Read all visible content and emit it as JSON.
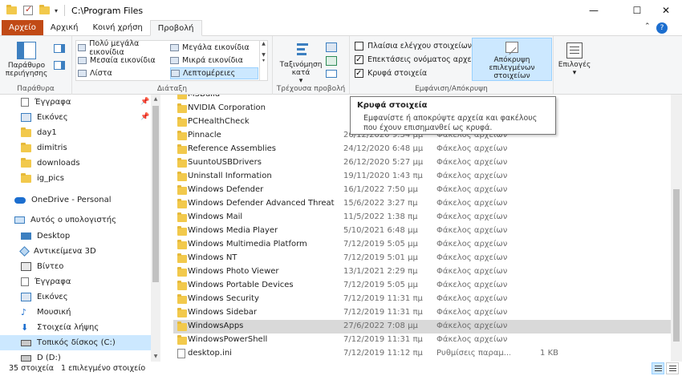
{
  "window": {
    "title": "C:\\Program Files",
    "min": "—",
    "max": "☐",
    "close": "✕"
  },
  "tabs": {
    "file": "Αρχείο",
    "home": "Αρχική",
    "share": "Κοινή χρήση",
    "view": "Προβολή"
  },
  "ribbon": {
    "panes": {
      "nav_pane": "Παράθυρο περιήγησης",
      "label": "Παράθυρα"
    },
    "layout": {
      "extra_large": "Πολύ μεγάλα εικονίδια",
      "large": "Μεγάλα εικονίδια",
      "medium": "Μεσαία εικονίδια",
      "small": "Μικρά εικονίδια",
      "list": "Λίστα",
      "details": "Λεπτομέρειες",
      "label": "Διάταξη"
    },
    "current_view": {
      "sort_by": "Ταξινόμηση κατά",
      "label": "Τρέχουσα προβολή"
    },
    "show_hide": {
      "item_checkboxes": "Πλαίσια ελέγχου στοιχείων",
      "file_extensions": "Επεκτάσεις ονόματος αρχείων",
      "hidden_items": "Κρυφά στοιχεία",
      "hide_selected": "Απόκρυψη επιλεγμένων στοιχείων",
      "item_checkboxes_checked": false,
      "file_extensions_checked": true,
      "hidden_items_checked": true,
      "label": "Εμφάνιση/Απόκρυψη"
    },
    "options": "Επιλογές"
  },
  "nav": {
    "quick": [
      "Έγγραφα",
      "Εικόνες",
      "day1",
      "dimitris",
      "downloads",
      "ig_pics"
    ],
    "onedrive": "OneDrive - Personal",
    "thispc": "Αυτός ο υπολογιστής",
    "pc_items": [
      "Desktop",
      "Αντικείμενα 3D",
      "Βίντεο",
      "Έγγραφα",
      "Εικόνες",
      "Μουσική",
      "Στοιχεία λήψης",
      "Τοπικός δίσκος (C:)",
      "D (D:)"
    ]
  },
  "files": [
    {
      "name": "MSBuild",
      "date": "",
      "type": "",
      "size": ""
    },
    {
      "name": "NVIDIA Corporation",
      "date": "",
      "type": "",
      "size": ""
    },
    {
      "name": "PCHealthCheck",
      "date": "",
      "type": "",
      "size": ""
    },
    {
      "name": "Pinnacle",
      "date": "26/12/2020 9:34 μμ",
      "type": "Φάκελος αρχείων",
      "size": ""
    },
    {
      "name": "Reference Assemblies",
      "date": "24/12/2020 6:48 μμ",
      "type": "Φάκελος αρχείων",
      "size": ""
    },
    {
      "name": "SuuntoUSBDrivers",
      "date": "26/12/2020 5:27 μμ",
      "type": "Φάκελος αρχείων",
      "size": ""
    },
    {
      "name": "Uninstall Information",
      "date": "19/11/2020 1:43 πμ",
      "type": "Φάκελος αρχείων",
      "size": ""
    },
    {
      "name": "Windows Defender",
      "date": "16/1/2022 7:50 μμ",
      "type": "Φάκελος αρχείων",
      "size": ""
    },
    {
      "name": "Windows Defender Advanced Threat Prot...",
      "date": "15/6/2022 3:27 πμ",
      "type": "Φάκελος αρχείων",
      "size": ""
    },
    {
      "name": "Windows Mail",
      "date": "11/5/2022 1:38 πμ",
      "type": "Φάκελος αρχείων",
      "size": ""
    },
    {
      "name": "Windows Media Player",
      "date": "5/10/2021 6:48 μμ",
      "type": "Φάκελος αρχείων",
      "size": ""
    },
    {
      "name": "Windows Multimedia Platform",
      "date": "7/12/2019 5:05 μμ",
      "type": "Φάκελος αρχείων",
      "size": ""
    },
    {
      "name": "Windows NT",
      "date": "7/12/2019 5:01 μμ",
      "type": "Φάκελος αρχείων",
      "size": ""
    },
    {
      "name": "Windows Photo Viewer",
      "date": "13/1/2021 2:29 πμ",
      "type": "Φάκελος αρχείων",
      "size": ""
    },
    {
      "name": "Windows Portable Devices",
      "date": "7/12/2019 5:05 μμ",
      "type": "Φάκελος αρχείων",
      "size": ""
    },
    {
      "name": "Windows Security",
      "date": "7/12/2019 11:31 πμ",
      "type": "Φάκελος αρχείων",
      "size": ""
    },
    {
      "name": "Windows Sidebar",
      "date": "7/12/2019 11:31 πμ",
      "type": "Φάκελος αρχείων",
      "size": ""
    },
    {
      "name": "WindowsApps",
      "date": "27/6/2022 7:08 μμ",
      "type": "Φάκελος αρχείων",
      "size": ""
    },
    {
      "name": "WindowsPowerShell",
      "date": "7/12/2019 11:31 πμ",
      "type": "Φάκελος αρχείων",
      "size": ""
    },
    {
      "name": "desktop.ini",
      "date": "7/12/2019 11:12 πμ",
      "type": "Ρυθμίσεις παραμ...",
      "size": "1 KB"
    }
  ],
  "selected_file": "WindowsApps",
  "tooltip": {
    "title": "Κρυφά στοιχεία",
    "body": "Εμφανίστε ή αποκρύψτε αρχεία και φακέλους που έχουν επισημανθεί ως κρυφά."
  },
  "status": {
    "count": "35 στοιχεία",
    "selected": "1 επιλεγμένο στοιχείο"
  },
  "colors": {
    "file_tab": "#c14a16",
    "selection": "#cce8ff",
    "folder": "#f2c94c"
  }
}
